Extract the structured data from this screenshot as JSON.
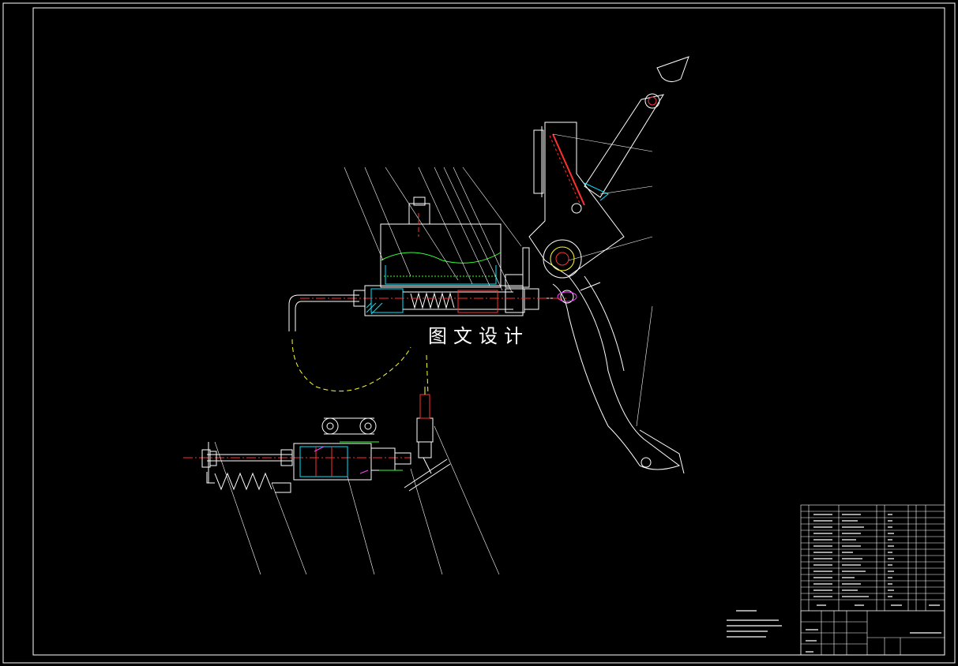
{
  "drawing": {
    "watermark": "图文设计"
  },
  "colors": {
    "background": "#000000",
    "outline": "#ffffff",
    "centerline": "#ff3030",
    "hatch": "#00e5ff",
    "fluid": "#33ff33",
    "pipe": "#ffff33",
    "accent": "#ff40ff"
  }
}
